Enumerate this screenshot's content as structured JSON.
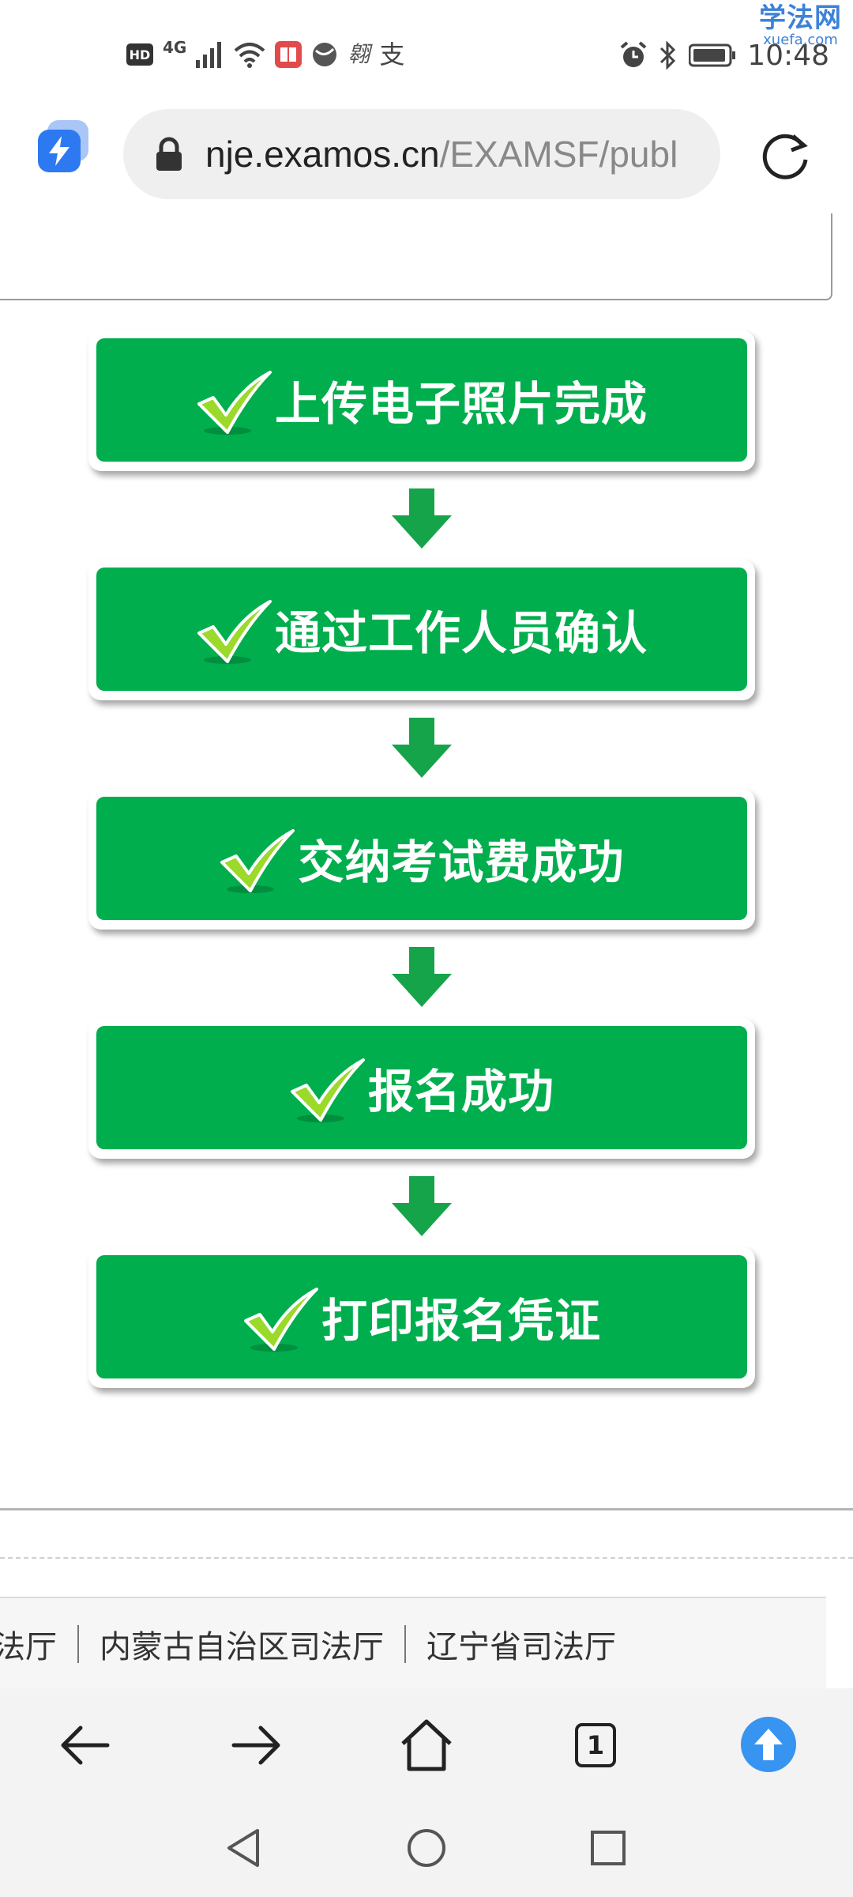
{
  "status_bar": {
    "hd": "HD",
    "network": "4G",
    "app_glyph_1": "翱",
    "app_glyph_2": "支",
    "time": "10:48"
  },
  "watermark": {
    "main": "学法网",
    "sub": "xuefa.com"
  },
  "browser": {
    "url_host": "nje.examos.cn",
    "url_path": "/EXAMSF/publ"
  },
  "steps": [
    {
      "label": "上传电子照片完成",
      "status": "done"
    },
    {
      "label": "通过工作人员确认",
      "status": "done"
    },
    {
      "label": "交纳考试费成功",
      "status": "done"
    },
    {
      "label": "报名成功",
      "status": "done"
    },
    {
      "label": "打印报名凭证",
      "status": "done"
    }
  ],
  "footer": {
    "links": [
      "司法厅",
      "内蒙古自治区司法厅",
      "辽宁省司法厅"
    ]
  },
  "bottom_nav": {
    "tab_count": "1"
  },
  "colors": {
    "step_green": "#00ae4d",
    "check_green": "#9bd92b",
    "accent_blue": "#3794f0"
  }
}
